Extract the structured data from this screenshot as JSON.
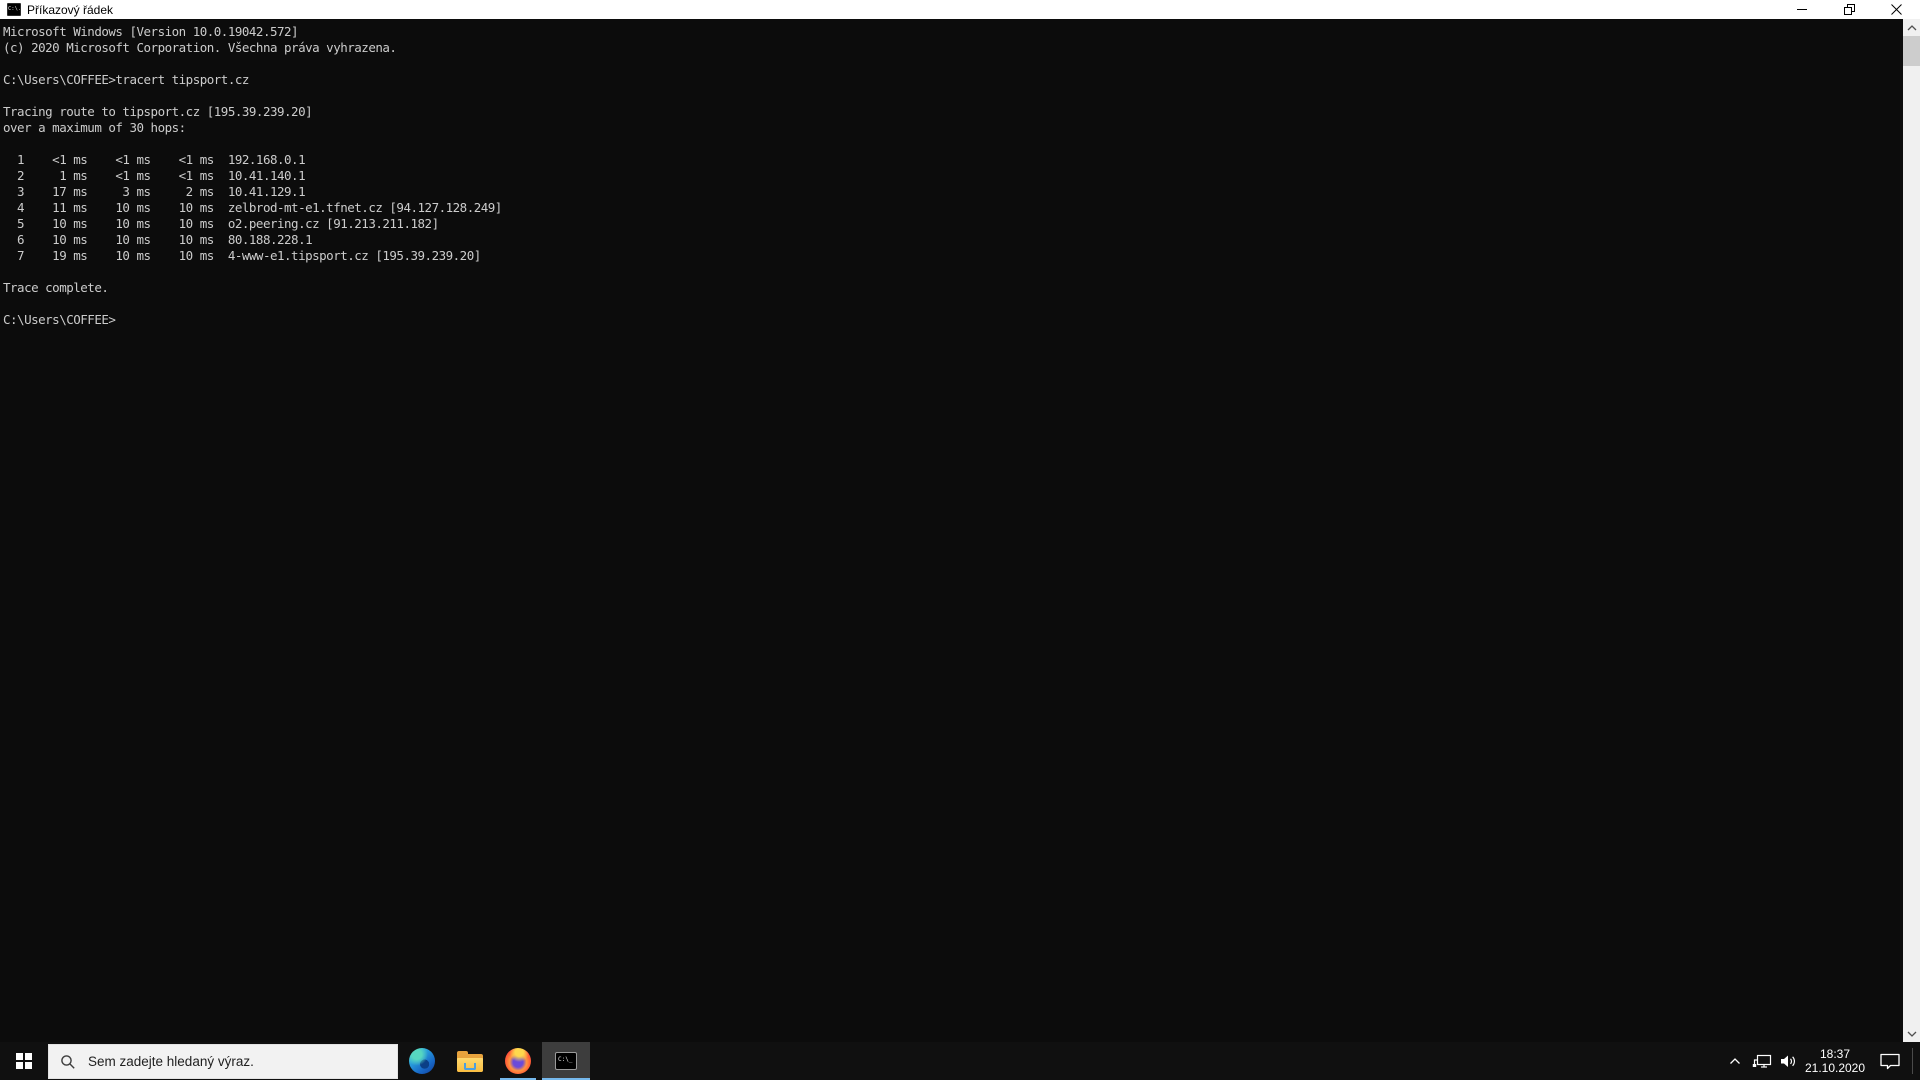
{
  "window": {
    "title": "Příkazový řádek",
    "app_icon": "C:\\.",
    "controls": [
      "minimize",
      "restore",
      "close"
    ]
  },
  "terminal": {
    "lines": [
      "Microsoft Windows [Version 10.0.19042.572]",
      "(c) 2020 Microsoft Corporation. Všechna práva vyhrazena.",
      "",
      "C:\\Users\\COFFEE>tracert tipsport.cz",
      "",
      "Tracing route to tipsport.cz [195.39.239.20]",
      "over a maximum of 30 hops:",
      "",
      "  1    <1 ms    <1 ms    <1 ms  192.168.0.1",
      "  2     1 ms    <1 ms    <1 ms  10.41.140.1",
      "  3    17 ms     3 ms     2 ms  10.41.129.1",
      "  4    11 ms    10 ms    10 ms  zelbrod-mt-e1.tfnet.cz [94.127.128.249]",
      "  5    10 ms    10 ms    10 ms  o2.peering.cz [91.213.211.182]",
      "  6    10 ms    10 ms    10 ms  80.188.228.1",
      "  7    19 ms    10 ms    10 ms  4-www-e1.tipsport.cz [195.39.239.20]",
      "",
      "Trace complete.",
      "",
      "C:\\Users\\COFFEE>"
    ],
    "colors": {
      "background": "#0c0c0c",
      "foreground": "#cccccc"
    }
  },
  "taskbar": {
    "search": {
      "placeholder": "Sem zadejte hledaný výraz."
    },
    "apps": [
      {
        "name": "edge",
        "running": false,
        "active": false
      },
      {
        "name": "file-explorer",
        "running": false,
        "active": false
      },
      {
        "name": "firefox",
        "running": true,
        "active": false
      },
      {
        "name": "command-prompt",
        "running": true,
        "active": true
      }
    ],
    "cmd_icon_text": "C:\\_",
    "tray": {
      "time": "18:37",
      "date": "21.10.2020"
    },
    "colors": {
      "background": "#101010",
      "running_underline": "#76b9ed"
    }
  }
}
